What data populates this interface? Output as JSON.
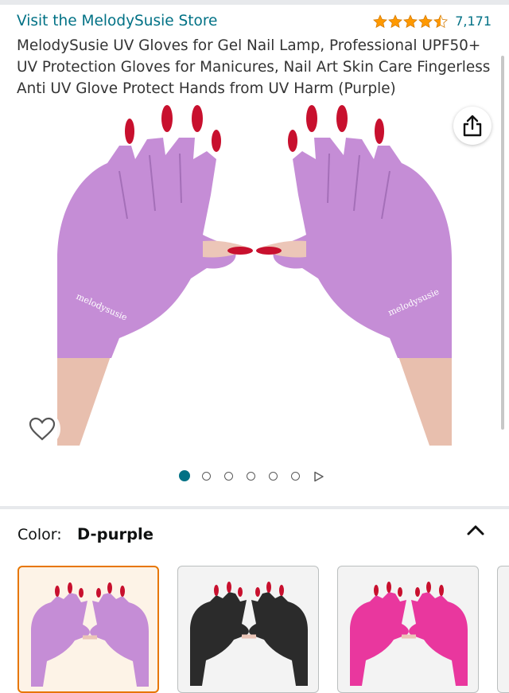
{
  "header": {
    "store_link": "Visit the MelodySusie Store",
    "rating_count": "7,171",
    "stars": 4.5,
    "star_color": "#ff9900"
  },
  "product": {
    "title": "MelodySusie UV Gloves for Gel Nail Lamp, Professional UPF50+ UV Protection Gloves for Manicures, Nail Art Skin Care Fingerless Anti UV Glove Protect Hands from UV Harm (Purple)",
    "glove_brand_print": "melodysusie"
  },
  "gallery": {
    "image_count": 6,
    "active_index": 0
  },
  "color_selector": {
    "label": "Color:",
    "value": "D-purple",
    "swatches": [
      {
        "name": "purple",
        "color": "#c58dd6",
        "selected": true
      },
      {
        "name": "black",
        "color": "#2b2b2b",
        "selected": false
      },
      {
        "name": "pink",
        "color": "#e9379e",
        "selected": false
      }
    ]
  },
  "colors": {
    "link": "#007185",
    "glove_purple": "#c58dd6",
    "nail_red": "#c8102e",
    "selected_border": "#e77600"
  }
}
